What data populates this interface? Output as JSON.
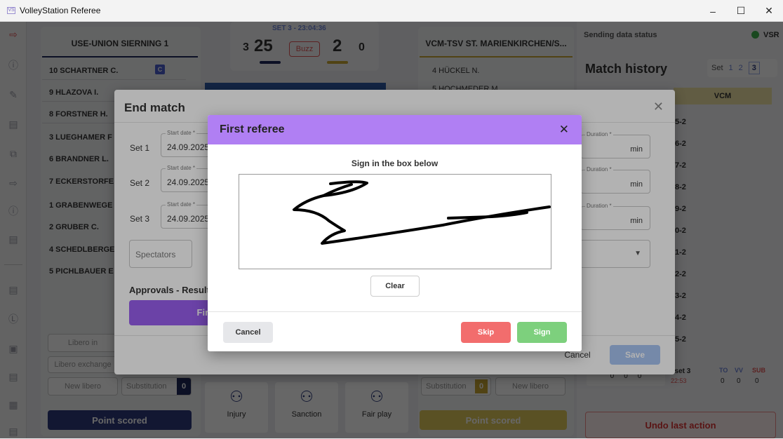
{
  "window": {
    "title": "VolleyStation Referee",
    "minimize": "–",
    "maximize": "☐",
    "close": "✕"
  },
  "teams": {
    "home": "USE-UNION SIERNING 1",
    "away": "VCM-TSV ST. MARIENKIRCHEN/S..."
  },
  "scoreboard": {
    "set_label": "SET 3 - 23:04:36",
    "home_sets": "3",
    "home_points": "25",
    "buzz": "Buzz",
    "away_points": "2",
    "away_sets": "0"
  },
  "home_players": [
    "10 SCHARTNER C.",
    "9 HLAZOVA I.",
    "8 FORSTNER H.",
    "3 LUEGHAMER F",
    "6 BRANDNER L.",
    "7 ECKERSTORFE",
    "1 GRABENWEGE",
    "2 GRUBER C.",
    "4 SCHEDLBERGE",
    "5 PICHLBAUER E"
  ],
  "captain_badge": "C",
  "away_players": [
    "4 HÜCKEL N.",
    "5 HOCHMEDER M."
  ],
  "status": {
    "label": "Sending data status",
    "vsr": "VSR"
  },
  "history": {
    "title": "Match history",
    "set_label": "Set",
    "sets": [
      "1",
      "2",
      "3"
    ],
    "team": "VCM",
    "rows": [
      "5-2",
      "6-2",
      "7-2",
      "8-2",
      "9-2",
      "0-2",
      "1-2",
      "2-2",
      "3-2",
      "4-2",
      "5-2"
    ]
  },
  "stats": {
    "set": "I set 3",
    "time": "22:53",
    "to": "TO",
    "vv": "VV",
    "sub": "SUB",
    "zeros": [
      "0",
      "0",
      "0"
    ],
    "right": [
      "0",
      "0",
      "0"
    ]
  },
  "home_controls": {
    "libero_in": "Libero in",
    "libero_exchange": "Libero exchange",
    "new_libero": "New libero",
    "substitution": "Substitution",
    "sub_count": "0",
    "point": "Point scored"
  },
  "away_controls": {
    "substitution": "Substitution",
    "sub_count": "0",
    "new_libero": "New libero",
    "point": "Point scored"
  },
  "center_actions": {
    "injury": "Injury",
    "sanction": "Sanction",
    "fair_play": "Fair play"
  },
  "undo": "Undo last action",
  "end_match": {
    "title": "End match",
    "close": "✕",
    "start_label": "Start date *",
    "duration_label": "Duration *",
    "sets": [
      {
        "label": "Set 1",
        "date": "24.09.2025"
      },
      {
        "label": "Set 2",
        "date": "24.09.2025"
      },
      {
        "label": "Set 3",
        "date": "24.09.2025"
      }
    ],
    "min": "min",
    "spectators": "Spectators",
    "approvals": "Approvals - Result",
    "first_referee": "First Referee",
    "cancel": "Cancel",
    "save": "Save"
  },
  "signature": {
    "title": "First referee",
    "close": "✕",
    "instruction": "Sign in the box below",
    "clear": "Clear",
    "cancel": "Cancel",
    "skip": "Skip",
    "sign": "Sign"
  },
  "colors": {
    "purple": "#b07ff3",
    "skip": "#f26d6d",
    "sign": "#7dd07d",
    "navy": "#1f2a5c",
    "gold": "#c8a533"
  }
}
